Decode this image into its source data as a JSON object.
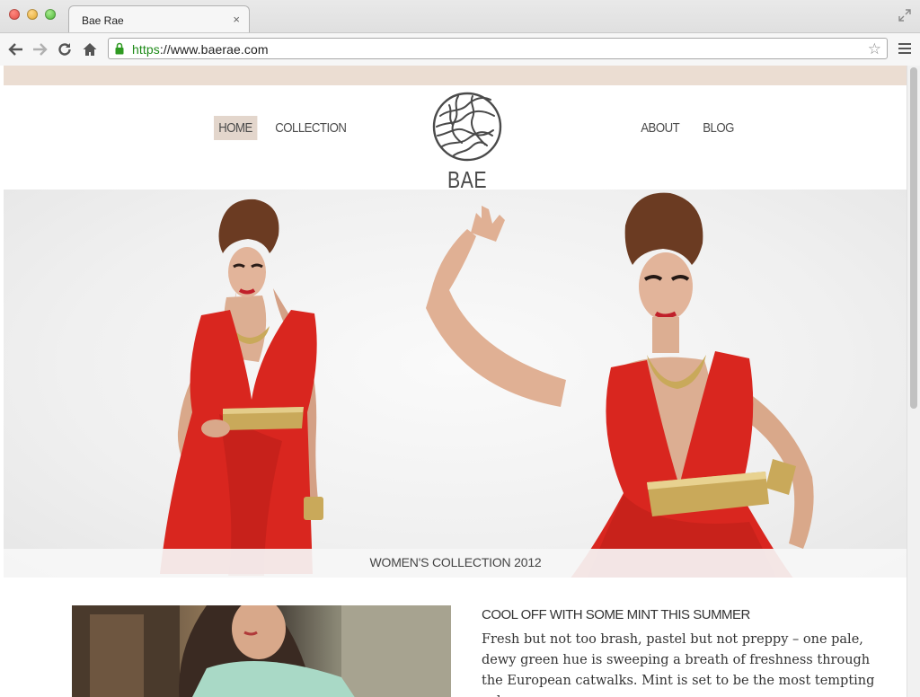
{
  "browser": {
    "tab_title": "Bae Rae",
    "tab_close": "×",
    "url_scheme": "https",
    "url_rest": "://www.baerae.com",
    "icons": [
      "back-icon",
      "forward-icon",
      "reload-icon",
      "home-icon",
      "lock-icon",
      "star-icon",
      "menu-icon",
      "fullscreen-icon"
    ]
  },
  "site": {
    "nav_left": [
      {
        "label": "HOME",
        "active": true
      },
      {
        "label": "COLLECTION",
        "active": false
      }
    ],
    "nav_right": [
      {
        "label": "ABOUT",
        "active": false
      },
      {
        "label": "BLOG",
        "active": false
      }
    ],
    "brand": "BAE RAE",
    "hero_caption": "WOMEN'S COLLECTION 2012",
    "article": {
      "title": "COOL OFF WITH SOME MINT THIS SUMMER",
      "body": "Fresh but not too brash, pastel but not preppy – one pale, dewy green hue is sweeping a breath of freshness through the European catwalks. Mint is set to be the most tempting color"
    }
  },
  "colors": {
    "accent_band": "#ebddd2",
    "active_nav": "#e3d6cc",
    "dress_red": "#d9261f",
    "gold": "#c9a95a"
  }
}
